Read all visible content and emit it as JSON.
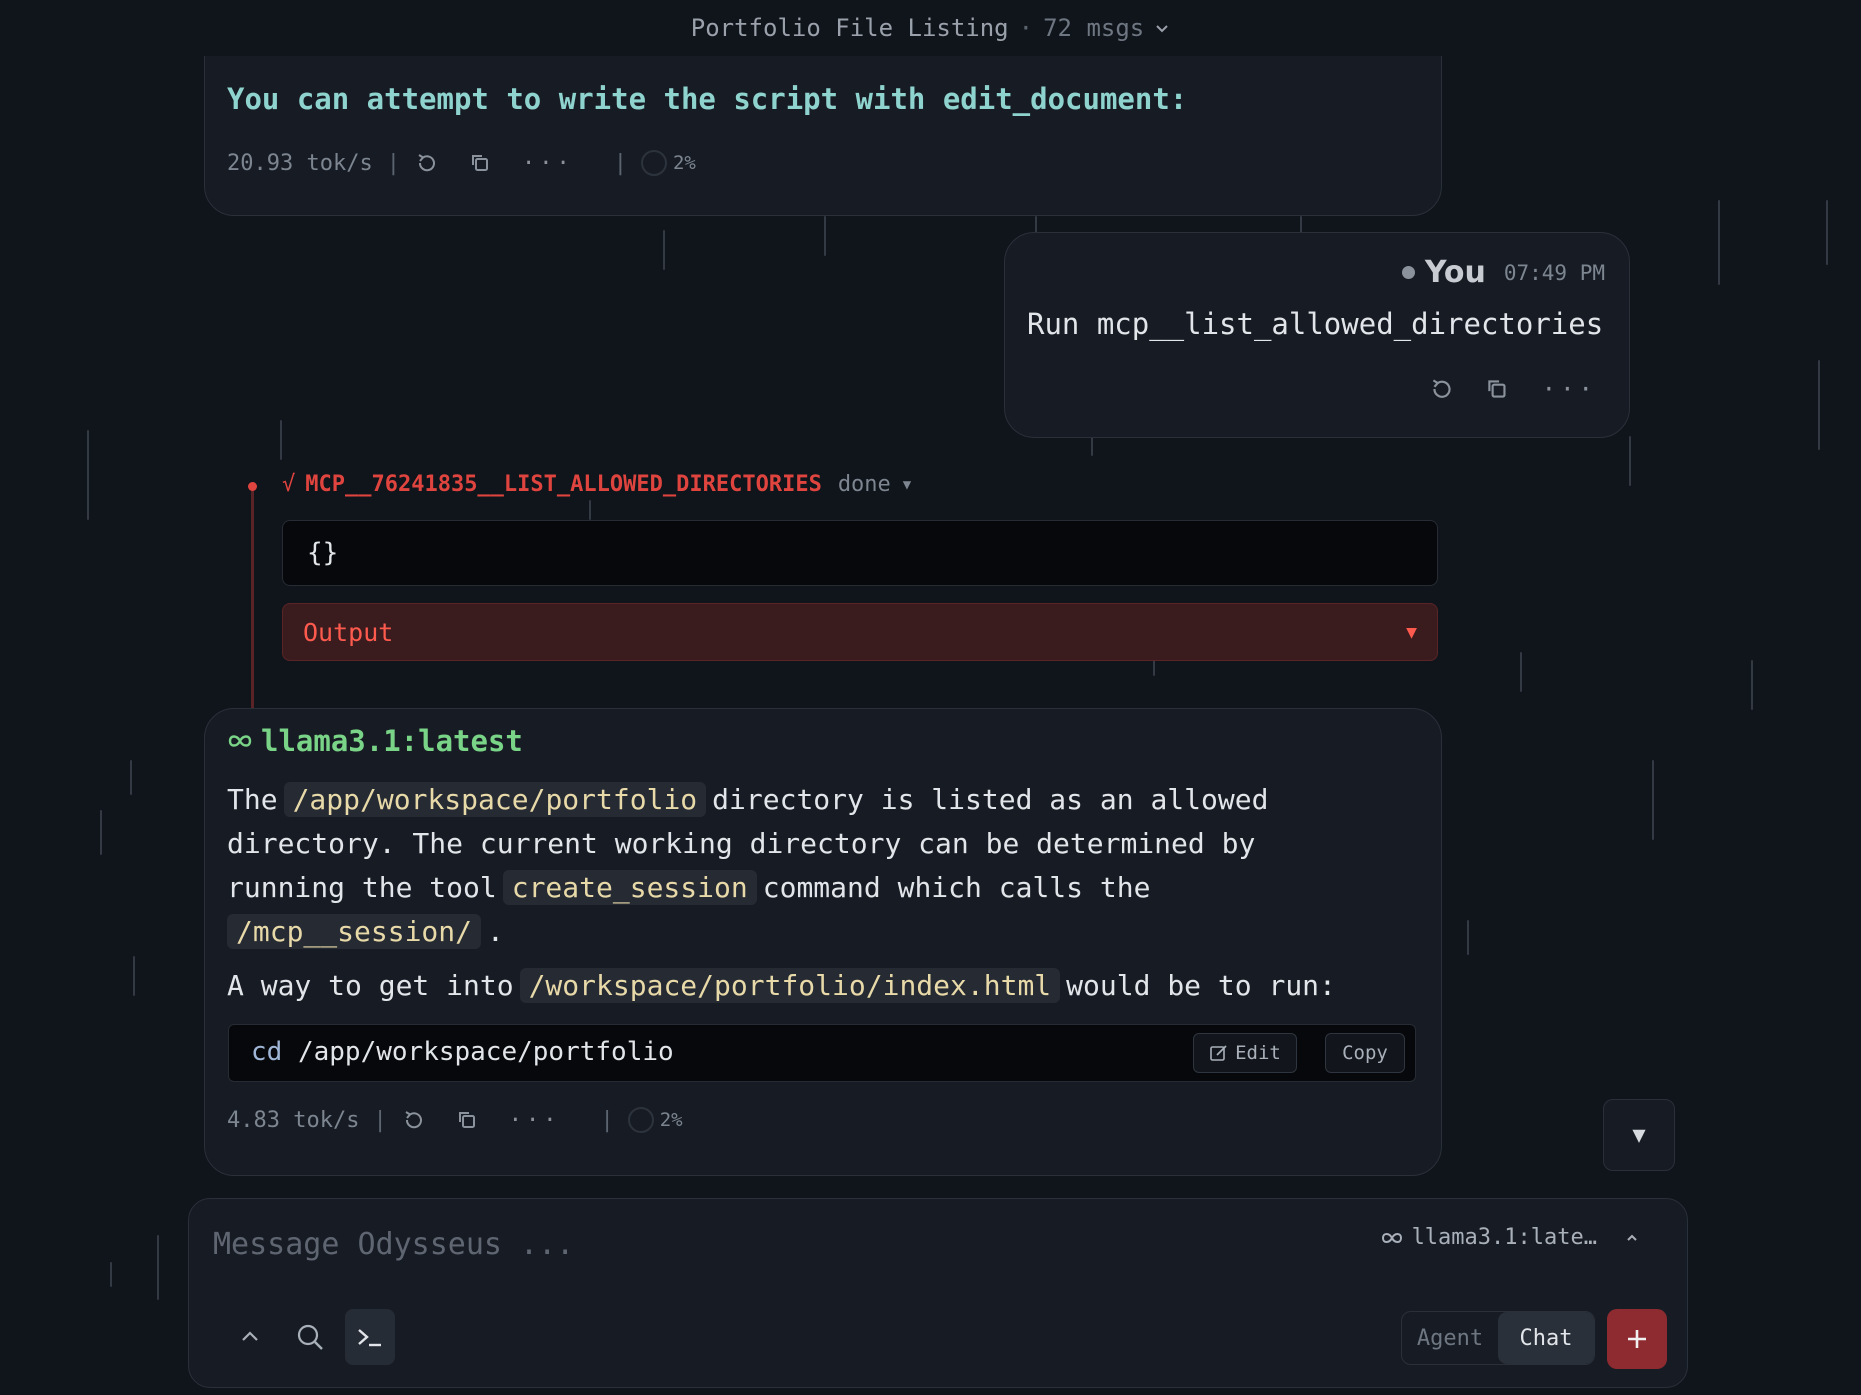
{
  "header": {
    "title": "Portfolio File Listing",
    "separator": "·",
    "message_count": "72 msgs"
  },
  "top_message": {
    "text": "You can attempt to write the script with edit_document:",
    "stats": {
      "speed": "20.93 tok/s",
      "separator": "|",
      "context_pct": "2%",
      "more": "···"
    }
  },
  "user_message": {
    "author": "You",
    "time": "07:49 PM",
    "text": "Run mcp__list_allowed_directories",
    "more": "···"
  },
  "tool_call": {
    "check": "√",
    "name": "MCP__76241835__LIST_ALLOWED_DIRECTORIES",
    "status": "done",
    "caret": "▼",
    "args": "{}",
    "output_label": "Output",
    "output_caret": "▼"
  },
  "assistant_message": {
    "model": "llama3.1:latest",
    "p1": {
      "t1": "The",
      "c1": "/app/workspace/portfolio",
      "t2": "directory is listed as an allowed",
      "t3": "directory. The current working directory can be determined by",
      "t4": "running the tool",
      "c2": "create_session",
      "t5": "command which calls the",
      "c3": "/mcp__session/",
      "t6": "."
    },
    "p2": {
      "t1": "A way to get into",
      "c1": "/workspace/portfolio/index.html",
      "t2": "would be to run:"
    },
    "code": {
      "keyword": "cd",
      "arg": "/app/workspace/portfolio",
      "edit_label": "Edit",
      "copy_label": "Copy"
    },
    "stats": {
      "speed": "4.83 tok/s",
      "separator": "|",
      "context_pct": "2%",
      "more": "···"
    }
  },
  "scroll_button": "▼",
  "composer": {
    "placeholder": "Message Odysseus ...",
    "model_label": "llama3.1:late…",
    "mode_agent": "Agent",
    "mode_chat": "Chat"
  },
  "colors": {
    "background": "#10141b",
    "card": "#171c24",
    "tool_red": "#e0443e",
    "model_green": "#7ad487",
    "accent_cyan": "#8fd3cf",
    "send_button": "#8e2b31"
  },
  "icons": [
    "chevron-down-icon",
    "regenerate-icon",
    "copy-icon",
    "more-icon",
    "context-ring-icon",
    "meta-infinity-icon",
    "edit-icon",
    "chevron-up-icon",
    "search-icon",
    "terminal-icon",
    "plus-icon"
  ]
}
